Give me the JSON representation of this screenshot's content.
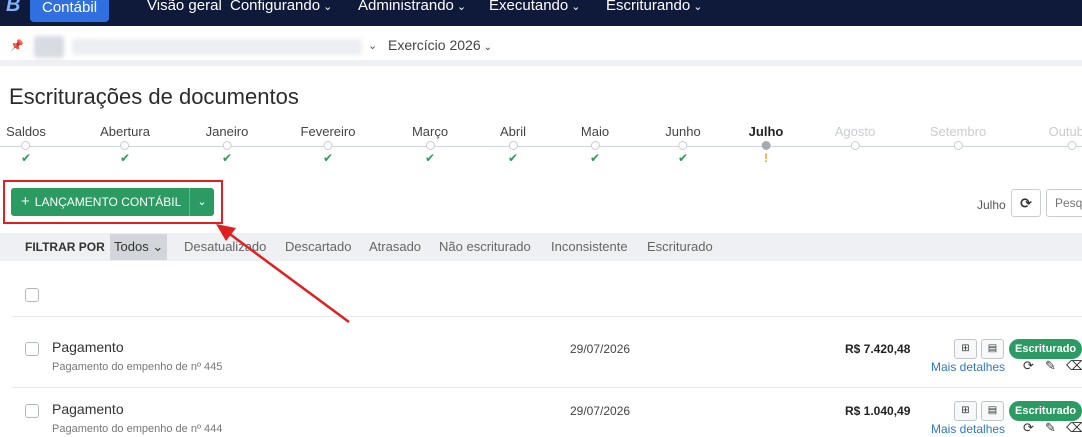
{
  "nav": {
    "logo": "B",
    "brand": "Contábil",
    "items": [
      {
        "label": "Visão geral",
        "has_menu": false
      },
      {
        "label": "Configurando",
        "has_menu": true
      },
      {
        "label": "Administrando",
        "has_menu": true
      },
      {
        "label": "Executando",
        "has_menu": true
      },
      {
        "label": "Escriturando",
        "has_menu": true
      }
    ]
  },
  "context": {
    "pin_icon": "pin-icon",
    "exercicio": "Exercício 2026"
  },
  "page": {
    "title": "Escriturações de documentos"
  },
  "timeline": {
    "months": [
      {
        "label": "Saldos",
        "status": "done"
      },
      {
        "label": "Abertura",
        "status": "done"
      },
      {
        "label": "Janeiro",
        "status": "done"
      },
      {
        "label": "Fevereiro",
        "status": "done"
      },
      {
        "label": "Março",
        "status": "done"
      },
      {
        "label": "Abril",
        "status": "done"
      },
      {
        "label": "Maio",
        "status": "done"
      },
      {
        "label": "Junho",
        "status": "done"
      },
      {
        "label": "Julho",
        "status": "warning"
      },
      {
        "label": "Agosto",
        "status": "future"
      },
      {
        "label": "Setembro",
        "status": "future"
      },
      {
        "label": "Outubro",
        "status": "future"
      }
    ],
    "check_glyph": "✔",
    "warn_glyph": "!"
  },
  "actions": {
    "plus": "+",
    "main_label": "LANÇAMENTO CONTÁBIL",
    "split_chevron": "⌄",
    "period_label": "Julho",
    "refresh_icon": "refresh-icon",
    "search_placeholder": "Pesquisar"
  },
  "filters": {
    "label": "FILTRAR POR",
    "active": "Todos",
    "items": [
      "Desatualizado",
      "Descartado",
      "Atrasado",
      "Não escriturado",
      "Inconsistente",
      "Escriturado"
    ]
  },
  "rows": [
    {
      "title": "Pagamento",
      "description": "Pagamento do empenho de nº 445",
      "date": "29/07/2026",
      "amount": "R$ 7.420,48",
      "status": "Escriturado",
      "more": "Mais detalhes"
    },
    {
      "title": "Pagamento",
      "description": "Pagamento do empenho de nº 444",
      "date": "29/07/2026",
      "amount": "R$ 1.040,49",
      "status": "Escriturado",
      "more": "Mais detalhes"
    }
  ],
  "colors": {
    "nav_bg": "#0f1a3a",
    "brand": "#2f6fe0",
    "accent_green": "#2c9a63",
    "highlight_red": "#e02020",
    "link_blue": "#2f78c4"
  }
}
